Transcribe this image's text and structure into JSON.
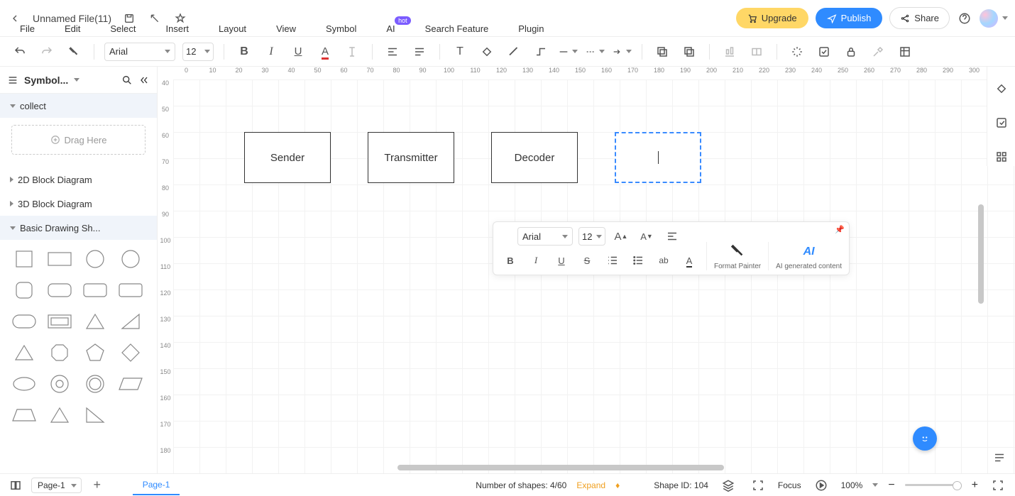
{
  "header": {
    "filename": "Unnamed File(11)",
    "upgrade": "Upgrade",
    "publish": "Publish",
    "share": "Share"
  },
  "menu": {
    "items": [
      "File",
      "Edit",
      "Select",
      "Insert",
      "Layout",
      "View",
      "Symbol",
      "AI",
      "Search Feature",
      "Plugin"
    ],
    "hot_badge": "hot"
  },
  "toolbar": {
    "font": "Arial",
    "size": "12"
  },
  "sidebar": {
    "title": "Symbol...",
    "sections": {
      "collect": "collect",
      "drag_here": "Drag Here",
      "s2d": "2D Block Diagram",
      "s3d": "3D Block Diagram",
      "basic": "Basic Drawing Sh..."
    }
  },
  "ruler_h": [
    "0",
    "10",
    "20",
    "30",
    "40",
    "50",
    "60",
    "70",
    "80",
    "90",
    "100",
    "110",
    "120",
    "130",
    "140",
    "150",
    "160",
    "170",
    "180",
    "190",
    "200",
    "210",
    "220",
    "230",
    "240",
    "250",
    "260",
    "270",
    "280",
    "290",
    "300"
  ],
  "ruler_v": [
    "40",
    "50",
    "60",
    "70",
    "80",
    "90",
    "100",
    "110",
    "120",
    "130",
    "140",
    "150",
    "160",
    "170",
    "180"
  ],
  "canvas": {
    "boxes": [
      {
        "label": "Sender"
      },
      {
        "label": "Transmitter"
      },
      {
        "label": "Decoder"
      },
      {
        "label": ""
      }
    ]
  },
  "float": {
    "font": "Arial",
    "size": "12",
    "format_painter": "Format Painter",
    "ai_label": "AI",
    "ai_text": "AI generated content"
  },
  "status": {
    "page_sel": "Page-1",
    "page_tab": "Page-1",
    "shapes_label": "Number of shapes: 4/60",
    "expand": "Expand",
    "shape_id": "Shape ID: 104",
    "focus": "Focus",
    "zoom": "100%"
  }
}
